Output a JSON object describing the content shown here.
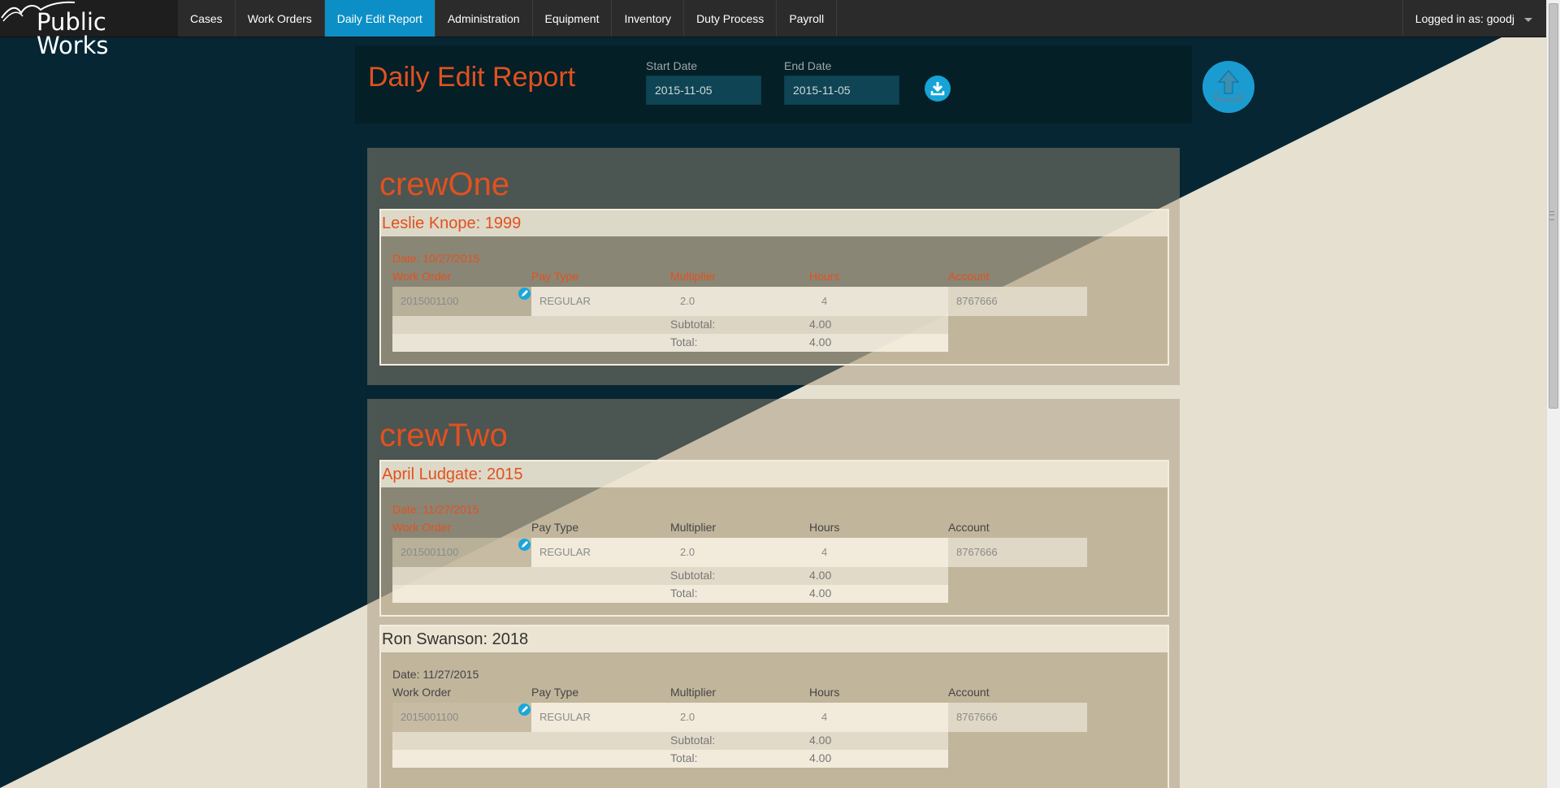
{
  "brand": {
    "name": "Public Works"
  },
  "nav": {
    "items": [
      {
        "label": "Cases"
      },
      {
        "label": "Work Orders"
      },
      {
        "label": "Daily Edit Report",
        "active": true
      },
      {
        "label": "Administration"
      },
      {
        "label": "Equipment"
      },
      {
        "label": "Inventory"
      },
      {
        "label": "Duty Process"
      },
      {
        "label": "Payroll"
      }
    ],
    "user": "Logged in as: goodj"
  },
  "header": {
    "title": "Daily Edit Report",
    "start_date_label": "Start Date",
    "start_date": "2015-11-05",
    "end_date_label": "End Date",
    "end_date": "2015-11-05",
    "download_icon": "download-icon",
    "upload_icon": "upload-icon"
  },
  "columns": {
    "work_order": "Work Order",
    "pay_type": "Pay Type",
    "multiplier": "Multiplier",
    "hours": "Hours",
    "account": "Account"
  },
  "crews": [
    {
      "name": "crewOne",
      "employees": [
        {
          "heading": "Leslie Knope: 1999",
          "date": "Date: 10/27/2015",
          "entry": {
            "work_order": "2015001100",
            "pay_type": "REGULAR",
            "multiplier": "2.0",
            "hours": "4",
            "account": "8767666"
          },
          "subtotal_label": "Subtotal:",
          "subtotal": "4.00",
          "total_label": "Total:",
          "total": "4.00"
        }
      ]
    },
    {
      "name": "crewTwo",
      "employees": [
        {
          "heading": "April Ludgate: 2015",
          "date": "Date: 11/27/2015",
          "entry": {
            "work_order": "2015001100",
            "pay_type": "REGULAR",
            "multiplier": "2.0",
            "hours": "4",
            "account": "8767666"
          },
          "subtotal_label": "Subtotal:",
          "subtotal": "4.00",
          "total_label": "Total:",
          "total": "4.00"
        },
        {
          "heading": "Ron Swanson: 2018",
          "date": "Date: 11/27/2015",
          "entry": {
            "work_order": "2015001100",
            "pay_type": "REGULAR",
            "multiplier": "2.0",
            "hours": "4",
            "account": "8767666"
          },
          "subtotal_label": "Subtotal:",
          "subtotal": "4.00",
          "total_label": "Total:",
          "total": "4.00"
        }
      ]
    }
  ]
}
